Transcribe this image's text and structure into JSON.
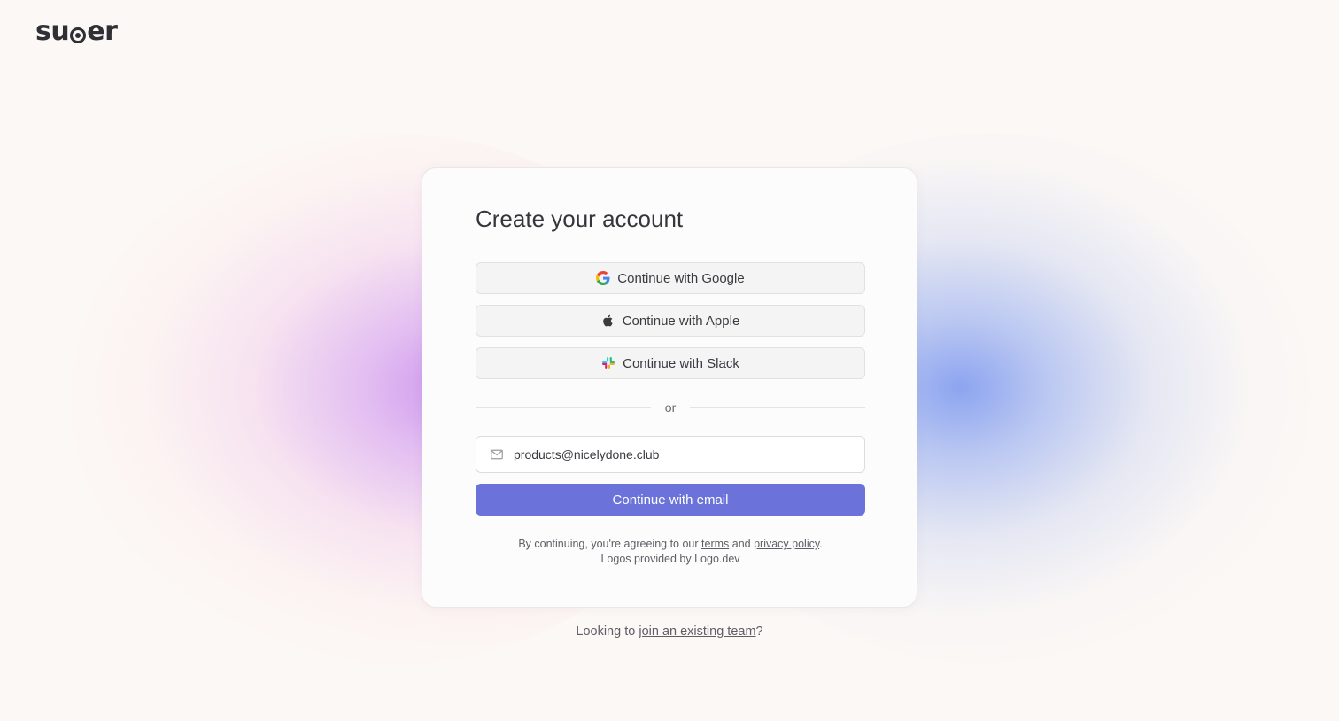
{
  "brand": {
    "logo_text_before": "su",
    "logo_text_after": "er"
  },
  "card": {
    "title": "Create your account",
    "sso": [
      {
        "label": "Continue with Google",
        "icon": "google-icon"
      },
      {
        "label": "Continue with Apple",
        "icon": "apple-icon"
      },
      {
        "label": "Continue with Slack",
        "icon": "slack-icon"
      }
    ],
    "divider_text": "or",
    "email": {
      "value": "products@nicelydone.club",
      "icon": "mail-icon"
    },
    "primary_button": "Continue with email",
    "legal": {
      "prefix": "By continuing, you're agreeing to our ",
      "terms": "terms",
      "and": " and ",
      "privacy": "privacy policy",
      "suffix": ".",
      "logos_note": "Logos provided by Logo.dev"
    }
  },
  "footer": {
    "prefix": "Looking to ",
    "link": "join an existing team",
    "suffix": "?"
  },
  "colors": {
    "primary": "#6b72d9",
    "background": "#fcf8f5",
    "glow_left": "#c88ceb",
    "glow_right": "#87a0f0"
  }
}
